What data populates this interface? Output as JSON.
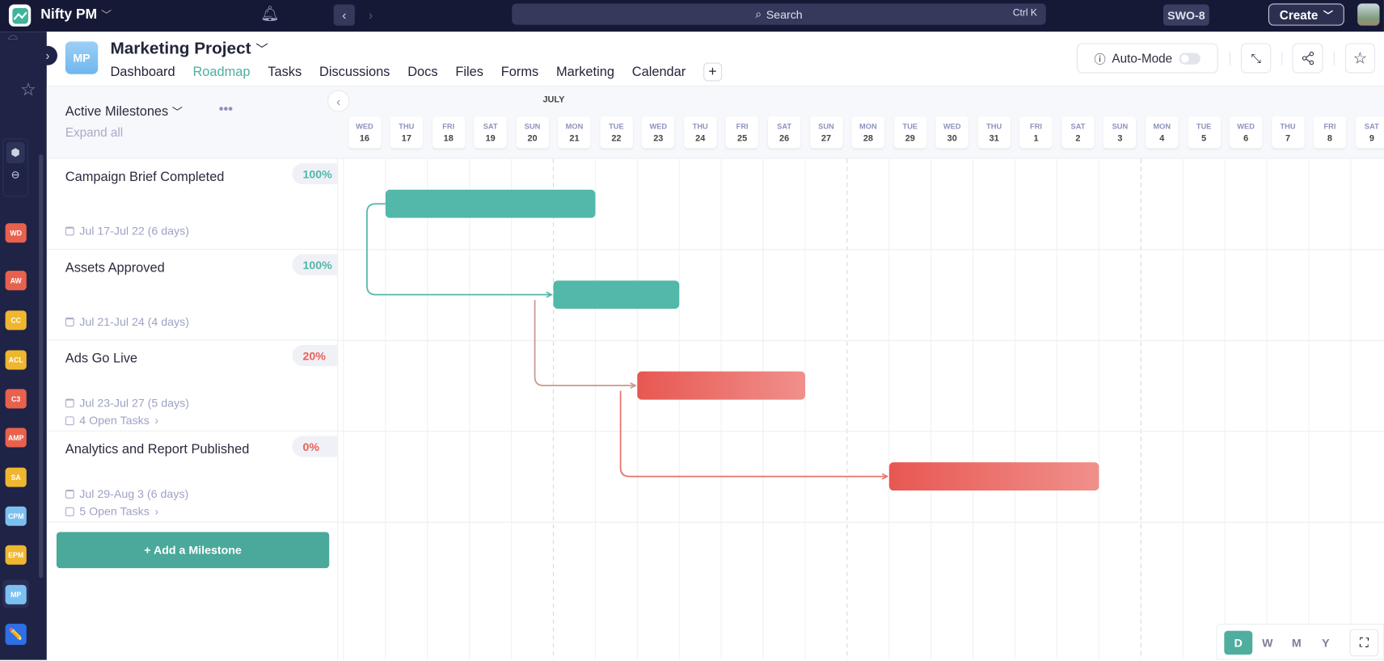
{
  "topbar": {
    "app_name": "Nifty PM",
    "search_label": "Search",
    "search_shortcut": "Ctrl K",
    "workspace_badge": "SWO-8",
    "create_label": "Create"
  },
  "sidebar": {
    "projects": [
      {
        "label": "WD",
        "color": "#e8614d"
      },
      {
        "label": "AW",
        "color": "#e8614d"
      },
      {
        "label": "CC",
        "color": "#efb730"
      },
      {
        "label": "ACL",
        "color": "#efb730"
      },
      {
        "label": "C3",
        "color": "#e8614d"
      },
      {
        "label": "AMP",
        "color": "#e8614d"
      },
      {
        "label": "SA",
        "color": "#efb730"
      },
      {
        "label": "CPM",
        "color": "#7cc0f0"
      },
      {
        "label": "EPM",
        "color": "#efb730"
      },
      {
        "label": "MP",
        "color": "#7cc0f0"
      }
    ]
  },
  "header": {
    "project_initials": "MP",
    "project_title": "Marketing Project",
    "tabs": [
      "Dashboard",
      "Roadmap",
      "Tasks",
      "Discussions",
      "Docs",
      "Files",
      "Forms",
      "Marketing",
      "Calendar"
    ],
    "active_tab": "Roadmap",
    "auto_mode_label": "Auto-Mode",
    "auto_mode_on": false
  },
  "milestones_panel": {
    "title": "Active Milestones",
    "expand_all": "Expand all",
    "add_label": "+ Add a Milestone"
  },
  "milestones": [
    {
      "name": "Campaign Brief Completed",
      "percent": "100%",
      "dates": "Jul 17-Jul 22 (6 days)",
      "open_tasks": "",
      "status": "done",
      "start": 17,
      "end": 22
    },
    {
      "name": "Assets Approved",
      "percent": "100%",
      "dates": "Jul 21-Jul 24 (4 days)",
      "open_tasks": "",
      "status": "done",
      "start": 21,
      "end": 24
    },
    {
      "name": "Ads Go Live",
      "percent": "20%",
      "dates": "Jul 23-Jul 27 (5 days)",
      "open_tasks": "4 Open Tasks",
      "status": "late",
      "start": 23,
      "end": 27
    },
    {
      "name": "Analytics and Report Published",
      "percent": "0%",
      "dates": "Jul 29-Aug 3 (6 days)",
      "open_tasks": "5 Open Tasks",
      "status": "late",
      "start": 29,
      "end": 34
    }
  ],
  "timeline": {
    "month": "JULY",
    "days": [
      [
        "WED",
        "16"
      ],
      [
        "THU",
        "17"
      ],
      [
        "FRI",
        "18"
      ],
      [
        "SAT",
        "19"
      ],
      [
        "SUN",
        "20"
      ],
      [
        "MON",
        "21"
      ],
      [
        "TUE",
        "22"
      ],
      [
        "WED",
        "23"
      ],
      [
        "THU",
        "24"
      ],
      [
        "FRI",
        "25"
      ],
      [
        "SAT",
        "26"
      ],
      [
        "SUN",
        "27"
      ],
      [
        "MON",
        "28"
      ],
      [
        "TUE",
        "29"
      ],
      [
        "WED",
        "30"
      ],
      [
        "THU",
        "31"
      ],
      [
        "FRI",
        "1"
      ],
      [
        "SAT",
        "2"
      ],
      [
        "SUN",
        "3"
      ],
      [
        "MON",
        "4"
      ],
      [
        "TUE",
        "5"
      ],
      [
        "WED",
        "6"
      ],
      [
        "THU",
        "7"
      ],
      [
        "FRI",
        "8"
      ],
      [
        "SAT",
        "9"
      ]
    ],
    "first_day": 16
  },
  "view_modes": [
    "D",
    "W",
    "M",
    "Y"
  ],
  "active_view": "D",
  "colors": {
    "done": "#52b8a9",
    "late": "#e8605a",
    "accent": "#4fae9f"
  }
}
